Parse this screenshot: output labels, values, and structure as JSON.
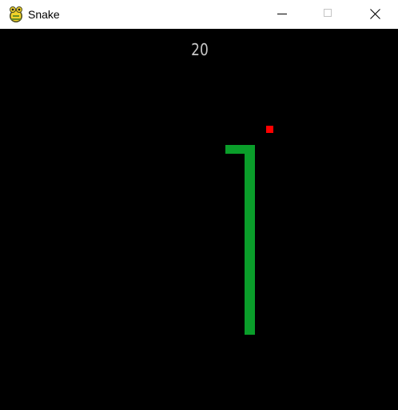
{
  "window": {
    "title": "Snake",
    "app_icon": "pygame-snake-icon"
  },
  "controls": {
    "minimize_icon": "minimize-icon",
    "maximize_icon": "maximize-icon",
    "close_icon": "close-icon"
  },
  "game": {
    "score": "20",
    "colors": {
      "background": "#000000",
      "snake": "#0a9e2a",
      "food": "#ff0000",
      "score_text": "#c8c8c8"
    }
  }
}
